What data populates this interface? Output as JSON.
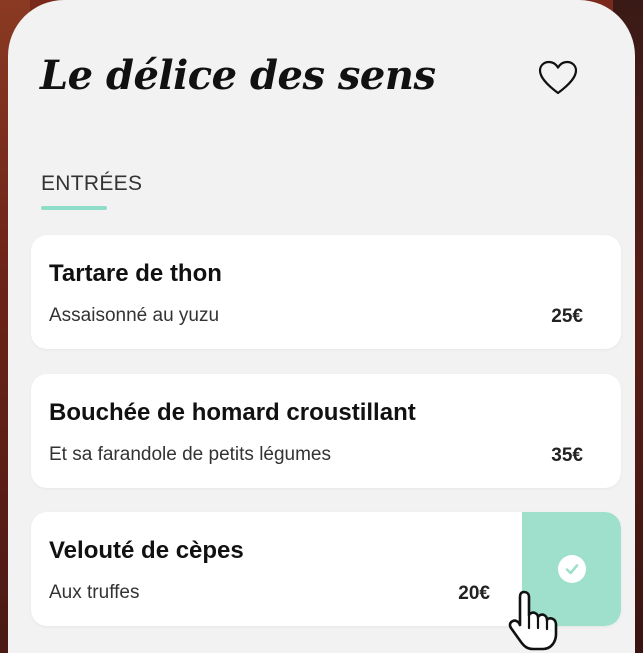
{
  "header": {
    "title": "Le délice des sens",
    "favorite_icon": "heart-outline-icon"
  },
  "section": {
    "label": "ENTRÉES",
    "accent_color": "#8fdcc8"
  },
  "menu_items": [
    {
      "name": "Tartare de thon",
      "description": "Assaisonné au yuzu",
      "price": "25€"
    },
    {
      "name": "Bouchée de homard croustillant",
      "description": "Et sa farandole de petits légumes",
      "price": "35€"
    },
    {
      "name": "Velouté de cèpes",
      "description": "Aux truffes",
      "price": "20€"
    }
  ],
  "swipe_action": {
    "icon": "check-circle-icon",
    "color": "#9fe0cc"
  },
  "pointer": {
    "icon": "hand-pointer-icon"
  }
}
